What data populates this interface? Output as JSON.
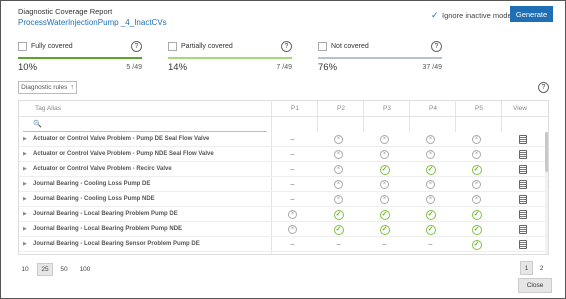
{
  "header": {
    "title": "Diagnostic Coverage Report",
    "subtitle": "ProcessWaterInjectionPump _4_InactCVs",
    "ignore_label": "Ignore inactive models",
    "generate_label": "Generate"
  },
  "stats": [
    {
      "label": "Fully covered",
      "percent": "10%",
      "count": "5 /49",
      "fill": 0.1,
      "color": "#5aa52a"
    },
    {
      "label": "Partially covered",
      "percent": "14%",
      "count": "7 /49",
      "fill": 0.14,
      "color": "#a7d77a"
    },
    {
      "label": "Not covered",
      "percent": "76%",
      "count": "37 /49",
      "fill": 0.76,
      "color": "#b8c2cc"
    }
  ],
  "toolbar": {
    "rules_label": "Diagnostic rules",
    "rules_sort_icon": "arrow-up-icon"
  },
  "table": {
    "columns": {
      "tag": "Tag Alias",
      "p1": "P1",
      "p2": "P2",
      "p3": "P3",
      "p4": "P4",
      "p5": "P5",
      "view": "View"
    },
    "rows": [
      {
        "name": "Actuator or Control Valve Problem - Pump DE Seal Flow Valve",
        "cells": [
          "dash",
          "x",
          "x",
          "x",
          "x"
        ]
      },
      {
        "name": "Actuator or Control Valve Problem - Pump NDE Seal Flow Valve",
        "cells": [
          "dash",
          "x",
          "x",
          "x",
          "x"
        ]
      },
      {
        "name": "Actuator or Control Valve Problem - Recirc Valve",
        "cells": [
          "dash",
          "x",
          "ok",
          "ok",
          "ok"
        ]
      },
      {
        "name": "Journal Bearing - Cooling Loss Pump DE",
        "cells": [
          "dash",
          "x",
          "x",
          "x",
          "x"
        ]
      },
      {
        "name": "Journal Bearing - Cooling Loss Pump NDE",
        "cells": [
          "dash",
          "x",
          "x",
          "x",
          "x"
        ]
      },
      {
        "name": "Journal Bearing - Local Bearing Problem Pump DE",
        "cells": [
          "x",
          "ok",
          "ok",
          "ok",
          "ok"
        ]
      },
      {
        "name": "Journal Bearing - Local Bearing Problem Pump NDE",
        "cells": [
          "x",
          "ok",
          "ok",
          "ok",
          "ok"
        ]
      },
      {
        "name": "Journal Bearing - Local Bearing Sensor Problem Pump DE",
        "cells": [
          "dash",
          "dash",
          "dash",
          "dash",
          "ok"
        ]
      }
    ]
  },
  "pagination": {
    "sizes": [
      "10",
      "25",
      "50",
      "100"
    ],
    "active_size": "25",
    "pages": [
      "1",
      "2"
    ],
    "active_page": "1"
  },
  "footer": {
    "close_label": "Close"
  }
}
